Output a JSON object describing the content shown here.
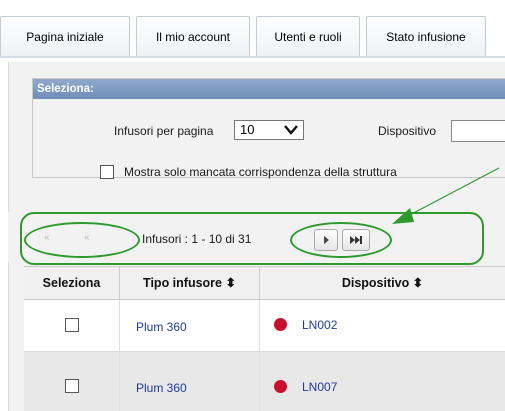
{
  "tabs": [
    {
      "label": "Pagina iniziale"
    },
    {
      "label": "Il mio account"
    },
    {
      "label": "Utenti e ruoli"
    },
    {
      "label": "Stato infusione"
    }
  ],
  "filter_panel": {
    "header": "Seleziona:",
    "per_page_label": "Infusori per pagina",
    "per_page_value": "10",
    "device_label": "Dispositivo",
    "mismatch_label": "Mostra solo mancata corrispondenza della struttura"
  },
  "pager": {
    "first_label": "«‹",
    "prev_label": "‹",
    "next_label": "▸",
    "last_label": "⏭",
    "summary": "Infusori : 1 - 10 di 31"
  },
  "table": {
    "headers": [
      "Seleziona",
      "Tipo infusore ⬍",
      "Dispositivo ⬍"
    ],
    "rows": [
      {
        "type": "Plum 360",
        "device": "LN002"
      },
      {
        "type": "Plum 360",
        "device": "LN007"
      }
    ]
  },
  "colors": {
    "highlight": "#2e9a2e",
    "status_dot": "#c8102e",
    "header_bar": "#7a96c2",
    "link": "#1e3a9e"
  }
}
